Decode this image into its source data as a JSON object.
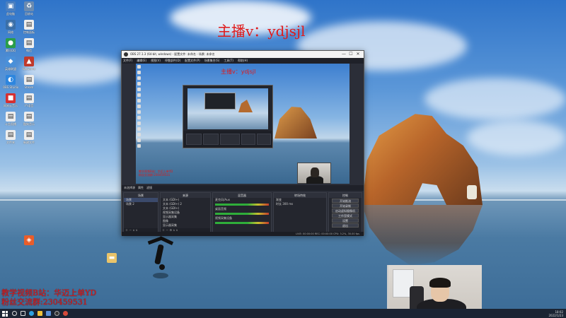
{
  "watermark": {
    "text": "主播v：ydjsjl"
  },
  "promo": {
    "line1": "教学视频B站：华迈上单YD",
    "line2": "粉丝交流群:230459531"
  },
  "obs": {
    "title": "OBS 27.1.3 (64-bit, windows) - 配置文件: 未命名 - 场景: 未命名",
    "minimize": "—",
    "maximize": "☐",
    "close": "✕",
    "menu": [
      "文件(F)",
      "编辑(E)",
      "视图(V)",
      "停靠部件(D)",
      "配置文件(P)",
      "场景集合(S)",
      "工具(T)",
      "帮助(H)"
    ],
    "preview_watermark": "主播v：ydjsjl",
    "preview_promo_line1": "教学视频B站：华迈上单YD",
    "preview_promo_line2": "粉丝交流群:230459531",
    "dock_bar": [
      "未选择源",
      "属性",
      "滤镜"
    ],
    "scenes": {
      "header": "场景",
      "items": [
        "场景",
        "场景 2"
      ]
    },
    "sources": {
      "header": "来源",
      "items": [
        "文本 (GDI+)",
        "文本 (GDI+) 2",
        "文本 (GDI+)",
        "视频采集设备",
        "显示器采集",
        "图像",
        "显示器采集"
      ]
    },
    "mixer": {
      "header": "混音器",
      "channels": [
        "麦克风/Aux",
        "桌面音频",
        "视频采集设备"
      ]
    },
    "transitions": {
      "header": "转场特效",
      "type": "渐变",
      "duration_label": "时长",
      "duration": "300 ms"
    },
    "controls": {
      "header": "控制",
      "buttons": [
        "开始推流",
        "开始录制",
        "启动虚拟摄像机",
        "工作室模式",
        "设置",
        "退出"
      ]
    },
    "status": "LIVE: 00:00:00   REC: 00:00:00   CPU: 3.2%, 30.00 fps"
  },
  "taskbar": {
    "time": "18:02",
    "date": "2022/1/23",
    "icons": [
      "search-icon",
      "task-view-icon",
      "edge-icon",
      "folder-icon",
      "store-icon",
      "obs-icon",
      "chrome-icon"
    ]
  },
  "desktop_icons": [
    "此电脑",
    "回收站",
    "网络",
    "控制面板",
    "腾讯QQ",
    "微信",
    "英雄联盟",
    "WeGame",
    "OBS Studio",
    "Steam",
    "网易云音乐",
    "YY语音",
    "斗鱼直播",
    "酷狗音乐",
    "文件夹",
    "新建文件"
  ],
  "colors": {
    "watermark": "#e01a1a",
    "obs_bg": "#2b2e38",
    "taskbar": "#1b2433"
  }
}
